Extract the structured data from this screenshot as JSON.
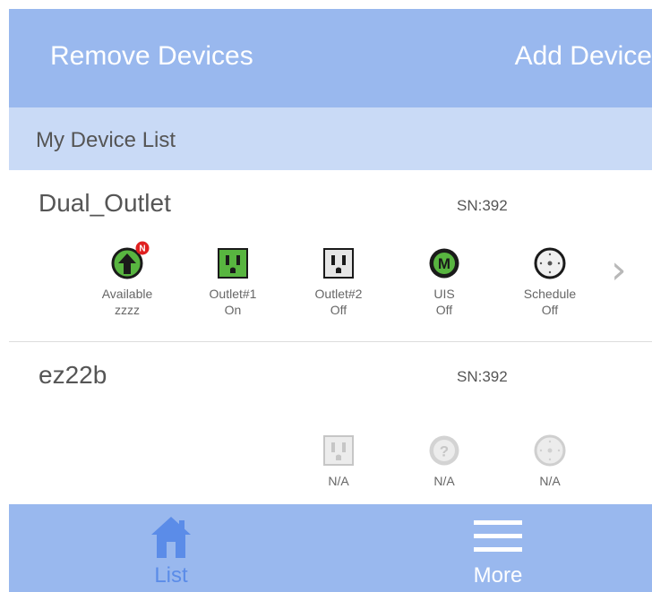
{
  "header": {
    "remove_label": "Remove Devices",
    "add_label": "Add Device"
  },
  "section": {
    "title": "My Device List"
  },
  "devices": [
    {
      "name": "Dual_Outlet",
      "sn": "SN:392",
      "items": [
        {
          "icon": "firmware-update-icon",
          "line1": "Available",
          "line2": "zzzz",
          "badge": "N"
        },
        {
          "icon": "outlet-on-icon",
          "line1": "Outlet#1",
          "line2": "On"
        },
        {
          "icon": "outlet-off-icon",
          "line1": "Outlet#2",
          "line2": "Off"
        },
        {
          "icon": "uis-icon",
          "badge": "M",
          "line1": "UIS",
          "line2": "Off"
        },
        {
          "icon": "schedule-clock-icon",
          "line1": "Schedule",
          "line2": "Off"
        }
      ]
    },
    {
      "name": "ez22b",
      "sn": "SN:392",
      "items": [
        {
          "icon": "outlet-disabled-icon",
          "line1": "N/A"
        },
        {
          "icon": "question-icon",
          "line1": "N/A"
        },
        {
          "icon": "schedule-disabled-icon",
          "line1": "N/A"
        }
      ]
    }
  ],
  "footer": {
    "tabs": [
      {
        "label": "List",
        "icon": "home-icon"
      },
      {
        "label": "More",
        "icon": "menu-icon"
      }
    ]
  },
  "colors": {
    "header_bg": "#99b8ee",
    "section_bg": "#c9daf6",
    "outlet_on": "#58b540",
    "active_tab": "#5b8ce8"
  }
}
